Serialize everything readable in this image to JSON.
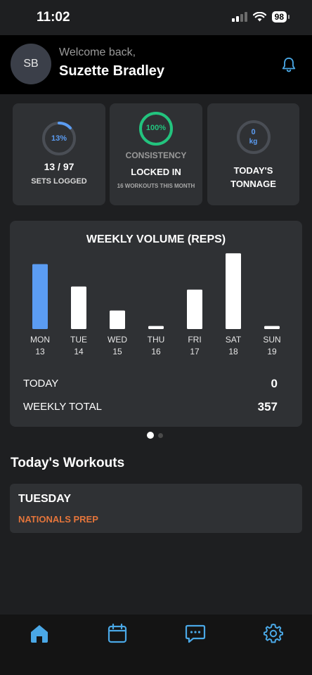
{
  "status_bar": {
    "time": "11:02",
    "battery": "98"
  },
  "header": {
    "avatar_initials": "SB",
    "welcome": "Welcome back,",
    "user_name": "Suzette Bradley"
  },
  "cards": {
    "sets": {
      "ring_value": "13%",
      "progress": 0.13,
      "title": "13 / 97",
      "subtitle": "SETS LOGGED"
    },
    "consistency": {
      "ring_value": "100%",
      "progress": 1.0,
      "label": "CONSISTENCY",
      "title": "LOCKED IN",
      "subtitle": "16 WORKOUTS THIS MONTH"
    },
    "tonnage": {
      "ring_value": "0",
      "ring_unit": "kg",
      "progress": 0,
      "title": "TODAY'S TONNAGE"
    }
  },
  "chart_data": {
    "type": "bar",
    "title": "WEEKLY VOLUME (REPS)",
    "categories": [
      "MON",
      "TUE",
      "WED",
      "THU",
      "FRI",
      "SAT",
      "SUN"
    ],
    "dates": [
      "13",
      "14",
      "15",
      "16",
      "17",
      "18",
      "19"
    ],
    "values": [
      84,
      55,
      24,
      4,
      51,
      98,
      4
    ],
    "ylim": [
      0,
      100
    ],
    "highlight_index": 0,
    "grid": false
  },
  "summary": {
    "today_label": "TODAY",
    "today_value": "0",
    "weekly_label": "WEEKLY TOTAL",
    "weekly_value": "357"
  },
  "workouts": {
    "section_title": "Today's Workouts",
    "items": [
      {
        "day": "TUESDAY",
        "name": "NATIONALS PREP"
      }
    ]
  },
  "colors": {
    "accent_blue": "#5b9cf2",
    "accent_green": "#22c47e",
    "accent_orange": "#e4753b",
    "tab_icon": "#4aa8e6"
  },
  "tabs": [
    "home-icon",
    "calendar-icon",
    "chat-icon",
    "settings-icon"
  ]
}
